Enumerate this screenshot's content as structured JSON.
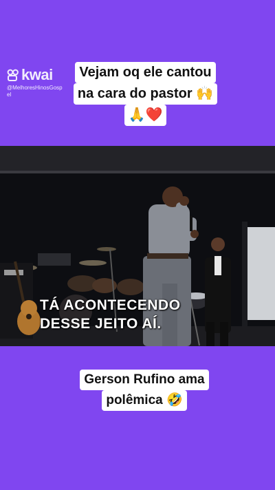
{
  "watermark": {
    "brand": "kwai",
    "handle": "@MelhoresHinosGospel",
    "icon": "kwai-logo-icon"
  },
  "caption_top": {
    "line1": "Vejam oq ele cantou",
    "line2": "na cara do pastor 🙌",
    "line3": "🙏❤️"
  },
  "video": {
    "subtitle_line1": "TÁ ACONTECENDO",
    "subtitle_line2": "DESSE JEITO AÍ."
  },
  "caption_bottom": {
    "line1": "Gerson Rufino ama",
    "line2": "polêmica 🤣"
  },
  "colors": {
    "background": "#8046f0",
    "caption_bg": "#ffffff",
    "video_bg": "#0b0b0d"
  }
}
